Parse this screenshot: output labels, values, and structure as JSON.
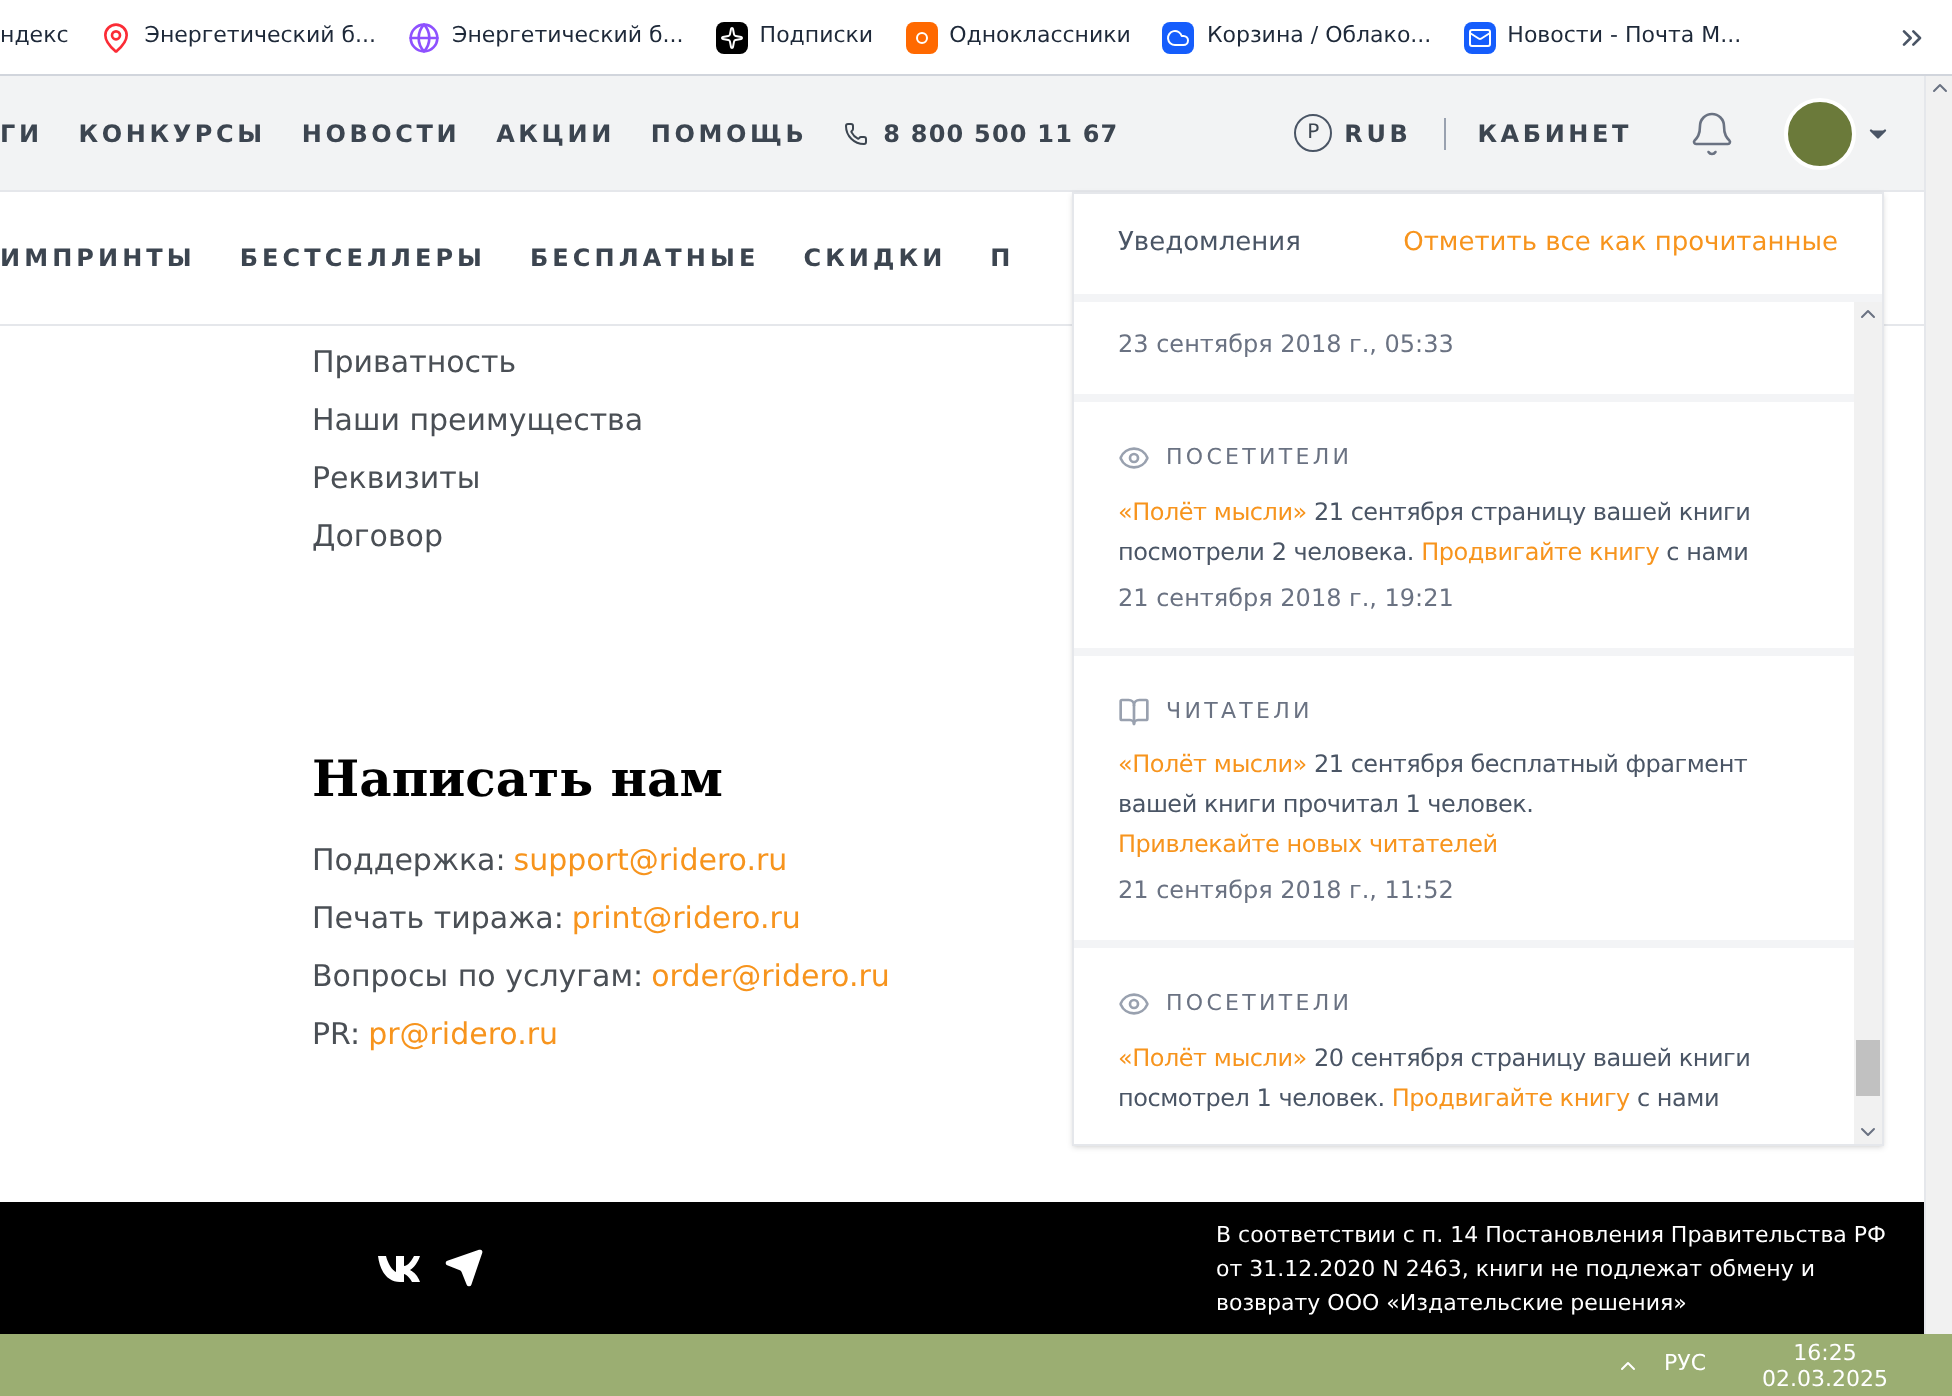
{
  "bookmarks": [
    {
      "label": "ндекс"
    },
    {
      "label": "Энергетический б..."
    },
    {
      "label": "Энергетический б..."
    },
    {
      "label": "Подписки"
    },
    {
      "label": "Одноклассники"
    },
    {
      "label": "Корзина / Облако..."
    },
    {
      "label": "Новости - Почта М..."
    }
  ],
  "header": {
    "nav": [
      "ГИ",
      "КОНКУРСЫ",
      "НОВОСТИ",
      "АКЦИИ",
      "ПОМОЩЬ"
    ],
    "phone": "8 800 500 11 67",
    "currency_symbol": "P",
    "currency": "RUB",
    "cabinet": "КАБИНЕТ"
  },
  "subnav": [
    "ИМПРИНТЫ",
    "БЕСТСЕЛЛЕРЫ",
    "БЕСПЛАТНЫЕ",
    "СКИДКИ",
    "П"
  ],
  "links": [
    "Приватность",
    "Наши преимущества",
    "Реквизиты",
    "Договор"
  ],
  "contact": {
    "title": "Написать нам",
    "rows": [
      {
        "label": "Поддержка:",
        "email": "support@ridero.ru"
      },
      {
        "label": "Печать тиража:",
        "email": "print@ridero.ru"
      },
      {
        "label": "Вопросы по услугам:",
        "email": "order@ridero.ru"
      },
      {
        "label": "PR:",
        "email": "pr@ridero.ru"
      }
    ]
  },
  "notifications": {
    "title": "Уведомления",
    "mark_all": "Отметить все как прочитанные",
    "items": [
      {
        "date": "23 сентября 2018 г., 05:33"
      },
      {
        "kind": "visitors",
        "category": "ПОСЕТИТЕЛИ",
        "parts": [
          {
            "text": "«Полёт мысли»",
            "link": true
          },
          {
            "text": " 21 сентября страницу вашей книги посмотрели 2 человека. ",
            "link": false
          },
          {
            "text": "Продвигайте книгу",
            "link": true
          },
          {
            "text": " с нами",
            "link": false
          }
        ],
        "date": "21 сентября 2018 г., 19:21"
      },
      {
        "kind": "readers",
        "category": "ЧИТАТЕЛИ",
        "parts": [
          {
            "text": "«Полёт мысли»",
            "link": true
          },
          {
            "text": " 21 сентября бесплатный фрагмент вашей книги прочитал 1 человек. ",
            "link": false
          },
          {
            "text": "Привлекайте новых читателей",
            "link": true
          }
        ],
        "date": "21 сентября 2018 г., 11:52"
      },
      {
        "kind": "visitors",
        "category": "ПОСЕТИТЕЛИ",
        "parts": [
          {
            "text": "«Полёт мысли»",
            "link": true
          },
          {
            "text": " 20 сентября страницу вашей книги посмотрел 1 человек. ",
            "link": false
          },
          {
            "text": "Продвигайте книгу",
            "link": true
          },
          {
            "text": " с нами",
            "link": false
          }
        ]
      }
    ]
  },
  "footer": {
    "notice": "В соответствии с п. 14 Постановления Правительства РФ от 31.12.2020 N 2463, книги не подлежат обмену и возврату ООО «Издательские решения»"
  },
  "taskbar": {
    "language": "РУС",
    "time": "16:25",
    "date": "02.03.2025"
  }
}
